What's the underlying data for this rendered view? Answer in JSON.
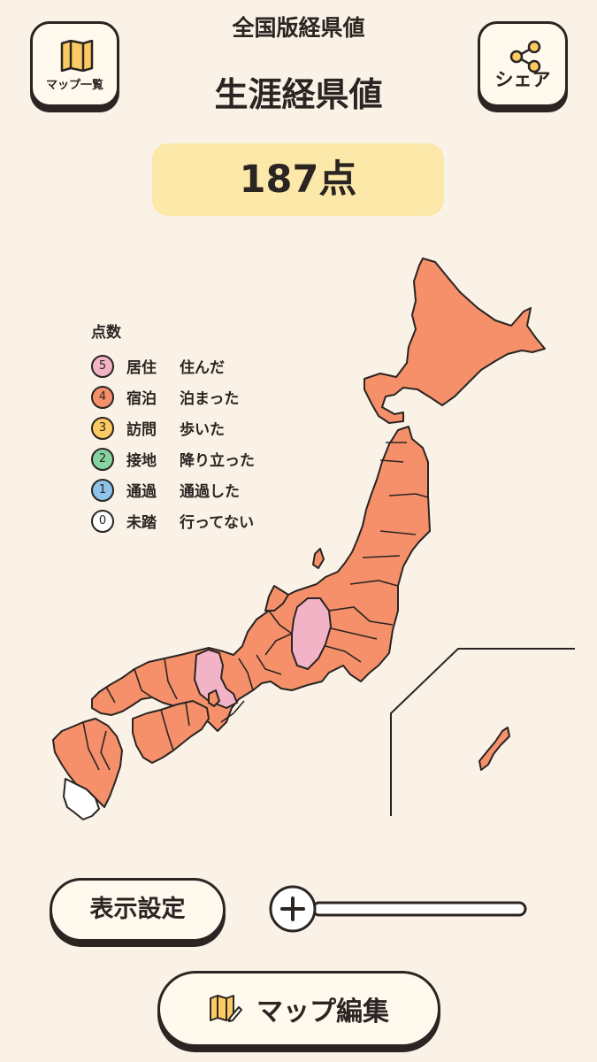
{
  "header": {
    "app_title": "全国版経県値",
    "page_title": "生涯経県値",
    "map_list_label": "マップ一覧",
    "share_label": "シェア"
  },
  "score": {
    "text": "187点"
  },
  "legend": {
    "title": "点数",
    "items": [
      {
        "score": "5",
        "label": "居住",
        "desc": "住んだ",
        "color": "#f2b3c7"
      },
      {
        "score": "4",
        "label": "宿泊",
        "desc": "泊まった",
        "color": "#f5906a"
      },
      {
        "score": "3",
        "label": "訪問",
        "desc": "歩いた",
        "color": "#fcca62"
      },
      {
        "score": "2",
        "label": "接地",
        "desc": "降り立った",
        "color": "#86d3a0"
      },
      {
        "score": "1",
        "label": "通過",
        "desc": "通過した",
        "color": "#8ec3ea"
      },
      {
        "score": "0",
        "label": "未踏",
        "desc": "行ってない",
        "color": "#ffffff"
      }
    ]
  },
  "colors": {
    "lived": "#f2b3c7",
    "stayed": "#f5906a",
    "unvisited": "#ffffff",
    "background": "#faf2e6"
  },
  "footer": {
    "display_settings_label": "表示設定",
    "map_edit_label": "マップ編集"
  }
}
